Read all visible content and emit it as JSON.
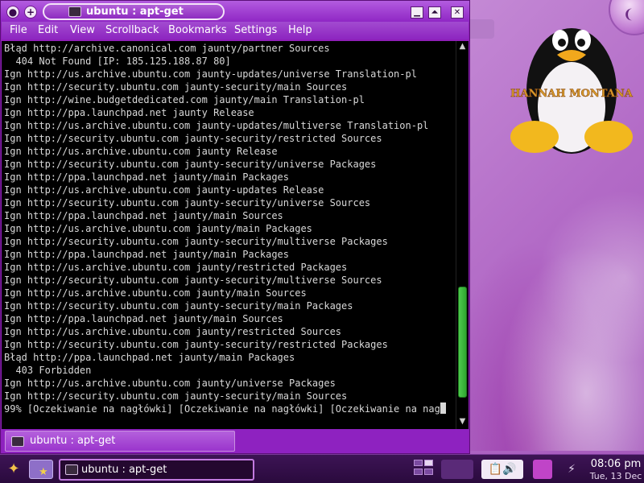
{
  "window": {
    "title": "ubuntu : apt-get",
    "controls": {
      "minimize": "▁",
      "maximize": "⏶",
      "close": "✕"
    },
    "titlebar_buttons": {
      "left_circle": "●",
      "plus": "+"
    }
  },
  "menubar": {
    "items": [
      "File",
      "Edit",
      "View",
      "Scrollback",
      "Bookmarks",
      "Settings",
      "Help"
    ]
  },
  "terminal": {
    "lines": [
      "Błąd http://archive.canonical.com jaunty/partner Sources",
      "  404 Not Found [IP: 185.125.188.87 80]",
      "Ign http://us.archive.ubuntu.com jaunty-updates/universe Translation-pl",
      "Ign http://security.ubuntu.com jaunty-security/main Sources",
      "Ign http://wine.budgetdedicated.com jaunty/main Translation-pl",
      "Ign http://ppa.launchpad.net jaunty Release",
      "Ign http://us.archive.ubuntu.com jaunty-updates/multiverse Translation-pl",
      "Ign http://security.ubuntu.com jaunty-security/restricted Sources",
      "Ign http://us.archive.ubuntu.com jaunty Release",
      "Ign http://security.ubuntu.com jaunty-security/universe Packages",
      "Ign http://ppa.launchpad.net jaunty/main Packages",
      "Ign http://us.archive.ubuntu.com jaunty-updates Release",
      "Ign http://security.ubuntu.com jaunty-security/universe Sources",
      "Ign http://ppa.launchpad.net jaunty/main Sources",
      "Ign http://us.archive.ubuntu.com jaunty/main Packages",
      "Ign http://security.ubuntu.com jaunty-security/multiverse Packages",
      "Ign http://ppa.launchpad.net jaunty/main Packages",
      "Ign http://us.archive.ubuntu.com jaunty/restricted Packages",
      "Ign http://security.ubuntu.com jaunty-security/multiverse Sources",
      "Ign http://us.archive.ubuntu.com jaunty/main Sources",
      "Ign http://security.ubuntu.com jaunty-security/main Packages",
      "Ign http://ppa.launchpad.net jaunty/main Sources",
      "Ign http://us.archive.ubuntu.com jaunty/restricted Sources",
      "Ign http://security.ubuntu.com jaunty-security/restricted Packages",
      "Błąd http://ppa.launchpad.net jaunty/main Packages",
      "  403 Forbidden",
      "Ign http://us.archive.ubuntu.com jaunty/universe Packages",
      "Ign http://security.ubuntu.com jaunty-security/main Sources"
    ],
    "progress_line": "99% [Oczekiwanie na nagłówki] [Oczekiwanie na nagłówki] [Oczekiwanie na nag",
    "scroll": {
      "up_arrow": "▲",
      "down_arrow": "▼",
      "thumb_position": 0.92
    },
    "colors": {
      "background": "#000000",
      "text": "#d8d8d8",
      "scroll_thumb": "#3db83d"
    }
  },
  "tabbar": {
    "tab_label": "ubuntu : apt-get"
  },
  "desktop": {
    "logo_text": "HANNAH MONTANA",
    "corner_glyph": "❨"
  },
  "taskbar": {
    "menu_glyph": "✦",
    "folder_star": "★",
    "task_label": "ubuntu : apt-get",
    "tray": {
      "clipboard": "📋",
      "volume": "🔊",
      "network": "⚡"
    },
    "clock": {
      "time": "08:06 pm",
      "date": "Tue, 13 Dec"
    }
  },
  "theme": {
    "accent": "#8f1fb8",
    "desktop": "#c58bd6",
    "taskbar": "#2a0a3d"
  }
}
